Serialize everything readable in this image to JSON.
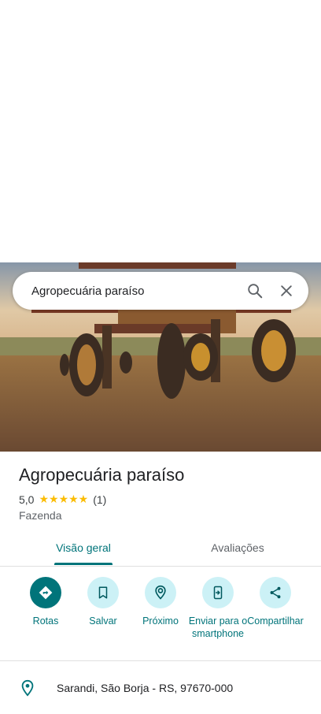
{
  "search": {
    "query": "Agropecuária paraíso"
  },
  "place": {
    "name": "Agropecuária paraíso",
    "rating": "5,0",
    "stars": "★★★★★",
    "review_count": "(1)",
    "category": "Fazenda"
  },
  "tabs": [
    {
      "label": "Visão geral",
      "active": true
    },
    {
      "label": "Avaliações",
      "active": false
    }
  ],
  "actions": [
    {
      "label": "Rotas",
      "icon": "directions-icon"
    },
    {
      "label": "Salvar",
      "icon": "bookmark-icon"
    },
    {
      "label": "Próximo",
      "icon": "nearby-icon"
    },
    {
      "label": "Enviar para o smartphone",
      "icon": "send-to-phone-icon"
    },
    {
      "label": "Compartilhar",
      "icon": "share-icon"
    }
  ],
  "details": {
    "address": "Sarandi, São Borja - RS, 97670-000"
  },
  "colors": {
    "accent": "#00747a",
    "action_bg": "#ccf1f6",
    "star": "#fbbc04"
  }
}
